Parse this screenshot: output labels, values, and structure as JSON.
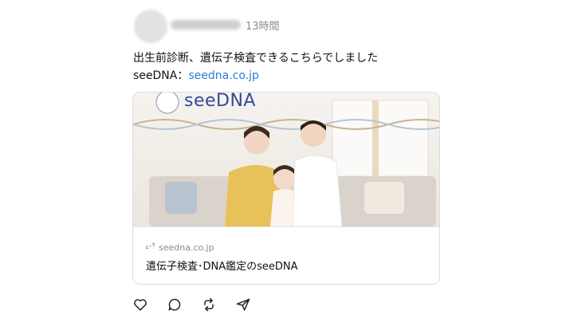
{
  "post": {
    "timestamp": "13時間",
    "text_line1": "出生前診断、遺伝子検査できるこちらでしました",
    "text_line2_prefix": "seeDNA：",
    "link_text": "seedna.co.jp"
  },
  "card": {
    "brand_logo_text": "seeDNA",
    "domain": "seedna.co.jp",
    "title": "遺伝子検査･DNA鑑定のseeDNA"
  },
  "actions": [
    {
      "icon": "heart-icon"
    },
    {
      "icon": "comment-icon"
    },
    {
      "icon": "repost-icon"
    },
    {
      "icon": "share-icon"
    }
  ],
  "colors": {
    "link": "#2b7fd8",
    "logo_blue": "#2e4a9c",
    "logo_light": "#5aa9e6"
  }
}
